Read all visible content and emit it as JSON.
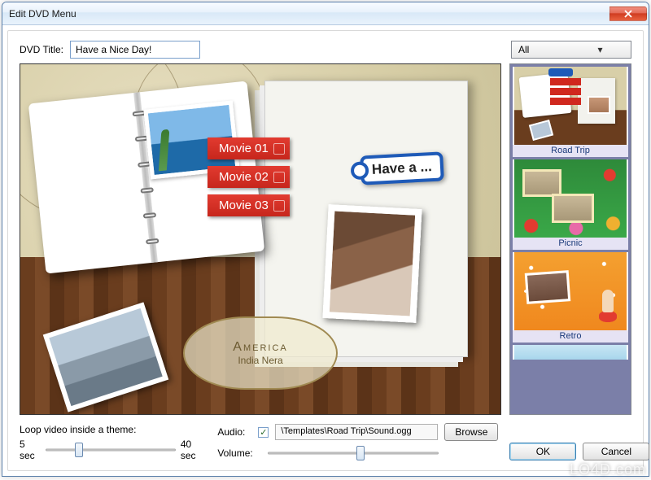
{
  "watermark": "LO4D.com",
  "window": {
    "title": "Edit DVD Menu"
  },
  "toprow": {
    "dvd_title_label": "DVD Title:",
    "dvd_title_value": "Have a Nice Day!",
    "filter_value": "All"
  },
  "preview": {
    "movies": [
      "Movie 01",
      "Movie 02",
      "Movie 03"
    ],
    "tag_text": "Have a ...",
    "cartouche_big": "America",
    "cartouche_small": "India Nera"
  },
  "templates": {
    "items": [
      {
        "label": "Road Trip"
      },
      {
        "label": "Picnic"
      },
      {
        "label": "Retro"
      }
    ]
  },
  "bottom": {
    "loop_label": "Loop video inside a theme:",
    "loop_min": "5 sec",
    "loop_max": "40 sec",
    "audio_label": "Audio:",
    "audio_checked": true,
    "audio_path": "\\Templates\\Road Trip\\Sound.ogg",
    "browse": "Browse",
    "volume_label": "Volume:",
    "ok": "OK",
    "cancel": "Cancel"
  }
}
